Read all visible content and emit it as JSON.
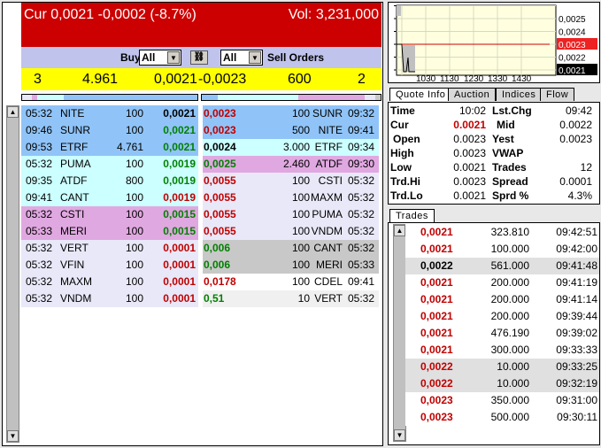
{
  "header": {
    "cur": "Cur 0,0021 -0,0002 (-8.7%)",
    "vol": "Vol: 3,231,000",
    "bg": "#cc0000"
  },
  "filter": {
    "buy_label": "Buy Orders",
    "buy_select": "All",
    "sell_select": "All",
    "sell_label": "Sell Orders",
    "link_icon": "chain-link-icon"
  },
  "summary": {
    "buy_count": "3",
    "buy_volume": "4.961",
    "bid": "0,0021",
    "ask": "-0,0023",
    "sell_volume": "600",
    "sell_count": "2"
  },
  "row_colors": {
    "blue": "#90c4f8",
    "cyan": "#ccffff",
    "pink": "#e0a8e0",
    "lavender": "#e8e8f8",
    "gray": "#c8c8c8",
    "white": "#ffffff",
    "light": "#f0f0f0"
  },
  "buy_orders": [
    {
      "time": "05:32",
      "code": "NITE",
      "vol": "100",
      "price": "0,0021",
      "pc": "black",
      "bg": "blue"
    },
    {
      "time": "09:46",
      "code": "SUNR",
      "vol": "100",
      "price": "0,0021",
      "pc": "grn",
      "bg": "blue"
    },
    {
      "time": "09:53",
      "code": "ETRF",
      "vol": "4.761",
      "price": "0,0021",
      "pc": "grn",
      "bg": "blue"
    },
    {
      "time": "05:32",
      "code": "PUMA",
      "vol": "100",
      "price": "0,0019",
      "pc": "grn",
      "bg": "cyan"
    },
    {
      "time": "09:35",
      "code": "ATDF",
      "vol": "800",
      "price": "0,0019",
      "pc": "grn",
      "bg": "cyan"
    },
    {
      "time": "09:41",
      "code": "CANT",
      "vol": "100",
      "price": "0,0019",
      "pc": "red",
      "bg": "cyan"
    },
    {
      "time": "05:32",
      "code": "CSTI",
      "vol": "100",
      "price": "0,0015",
      "pc": "grn",
      "bg": "pink"
    },
    {
      "time": "05:33",
      "code": "MERI",
      "vol": "100",
      "price": "0,0015",
      "pc": "grn",
      "bg": "pink"
    },
    {
      "time": "05:32",
      "code": "VERT",
      "vol": "100",
      "price": "0,0001",
      "pc": "red",
      "bg": "lavender"
    },
    {
      "time": "05:32",
      "code": "VFIN",
      "vol": "100",
      "price": "0,0001",
      "pc": "red",
      "bg": "lavender"
    },
    {
      "time": "05:32",
      "code": "MAXM",
      "vol": "100",
      "price": "0,0001",
      "pc": "red",
      "bg": "lavender"
    },
    {
      "time": "05:32",
      "code": "VNDM",
      "vol": "100",
      "price": "0,0001",
      "pc": "red",
      "bg": "lavender"
    }
  ],
  "sell_orders": [
    {
      "price": "0,0023",
      "pc": "red",
      "vol": "100",
      "code": "SUNR",
      "time": "09:32",
      "bg": "blue"
    },
    {
      "price": "0,0023",
      "pc": "red",
      "vol": "500",
      "code": "NITE",
      "time": "09:41",
      "bg": "blue"
    },
    {
      "price": "0,0024",
      "pc": "black",
      "vol": "3.000",
      "code": "ETRF",
      "time": "09:34",
      "bg": "cyan"
    },
    {
      "price": "0,0025",
      "pc": "grn",
      "vol": "2.460",
      "code": "ATDF",
      "time": "09:30",
      "bg": "pink"
    },
    {
      "price": "0,0055",
      "pc": "red",
      "vol": "100",
      "code": "CSTI",
      "time": "05:32",
      "bg": "lavender"
    },
    {
      "price": "0,0055",
      "pc": "red",
      "vol": "100",
      "code": "MAXM",
      "time": "05:32",
      "bg": "lavender"
    },
    {
      "price": "0,0055",
      "pc": "red",
      "vol": "100",
      "code": "PUMA",
      "time": "05:32",
      "bg": "lavender"
    },
    {
      "price": "0,0055",
      "pc": "red",
      "vol": "100",
      "code": "VNDM",
      "time": "05:32",
      "bg": "lavender"
    },
    {
      "price": "0,006",
      "pc": "grn",
      "vol": "100",
      "code": "CANT",
      "time": "05:32",
      "bg": "gray"
    },
    {
      "price": "0,006",
      "pc": "grn",
      "vol": "100",
      "code": "MERI",
      "time": "05:33",
      "bg": "gray"
    },
    {
      "price": "0,0178",
      "pc": "red",
      "vol": "100",
      "code": "CDEL",
      "time": "09:41",
      "bg": "white"
    },
    {
      "price": "0,51",
      "pc": "grn",
      "vol": "10",
      "code": "VERT",
      "time": "05:32",
      "bg": "light"
    }
  ],
  "chart": {
    "y_labels": [
      "0,0025",
      "0,0024",
      "0,0023",
      "0,0022",
      "0,0021"
    ],
    "x_labels": [
      "1030",
      "1130",
      "1230",
      "1330",
      "1430"
    ],
    "cur_label": "0,0023",
    "last_label": "0,0021"
  },
  "tabs": [
    "Quote Info",
    "Auction",
    "Indices",
    "Flow"
  ],
  "quote": [
    {
      "l1": "Time",
      "v1": "10:02",
      "l2": "Lst.Chg",
      "v2": "09:42"
    },
    {
      "l1": "Cur",
      "v1": "0.0021",
      "l2": "Mid",
      "v2": "0.0022"
    },
    {
      "l1": "Open",
      "v1": "0.0023",
      "l2": "Yest",
      "v2": "0.0023"
    },
    {
      "l1": "High",
      "v1": "0.0023",
      "l2": "VWAP",
      "v2": ""
    },
    {
      "l1": "Low",
      "v1": "0.0021",
      "l2": "Trades",
      "v2": "12"
    },
    {
      "l1": "Trd.Hi",
      "v1": "0.0023",
      "l2": "Spread",
      "v2": "0.0001"
    },
    {
      "l1": "Trd.Lo",
      "v1": "0.0021",
      "l2": "Sprd %",
      "v2": "4.3%"
    }
  ],
  "trades_tab": "Trades",
  "trades": [
    {
      "price": "0,0021",
      "pc": "red",
      "vol": "323.810",
      "time": "09:42:51",
      "hl": false
    },
    {
      "price": "0,0021",
      "pc": "red",
      "vol": "100.000",
      "time": "09:42:00",
      "hl": false
    },
    {
      "price": "0,0022",
      "pc": "black",
      "vol": "561.000",
      "time": "09:41:48",
      "hl": true
    },
    {
      "price": "0,0021",
      "pc": "red",
      "vol": "200.000",
      "time": "09:41:19",
      "hl": false
    },
    {
      "price": "0,0021",
      "pc": "red",
      "vol": "200.000",
      "time": "09:41:14",
      "hl": false
    },
    {
      "price": "0,0021",
      "pc": "red",
      "vol": "200.000",
      "time": "09:39:44",
      "hl": false
    },
    {
      "price": "0,0021",
      "pc": "red",
      "vol": "476.190",
      "time": "09:39:02",
      "hl": false
    },
    {
      "price": "0,0021",
      "pc": "red",
      "vol": "300.000",
      "time": "09:33:33",
      "hl": false
    },
    {
      "price": "0,0022",
      "pc": "red",
      "vol": "10.000",
      "time": "09:33:25",
      "hl": true
    },
    {
      "price": "0,0022",
      "pc": "red",
      "vol": "10.000",
      "time": "09:32:19",
      "hl": true
    },
    {
      "price": "0,0023",
      "pc": "red",
      "vol": "350.000",
      "time": "09:31:00",
      "hl": false
    },
    {
      "price": "0,0023",
      "pc": "red",
      "vol": "500.000",
      "time": "09:30:11",
      "hl": false
    }
  ]
}
